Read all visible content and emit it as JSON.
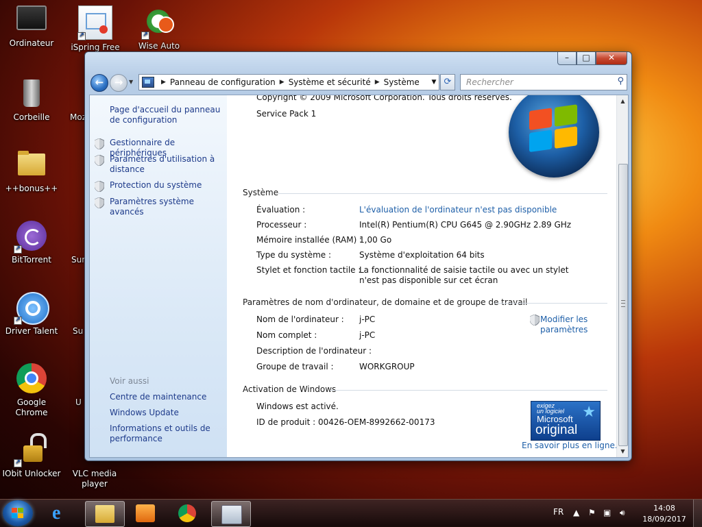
{
  "desktop": {
    "icons": [
      {
        "label": "Ordinateur"
      },
      {
        "label": "iSpring Free"
      },
      {
        "label": "Wise Auto"
      },
      {
        "label": "Corbeille"
      },
      {
        "label": "Moz"
      },
      {
        "label": "++bonus++"
      },
      {
        "label": "BitTorrent"
      },
      {
        "label": "Sur"
      },
      {
        "label": "Driver Talent"
      },
      {
        "label": "Su"
      },
      {
        "label": "Google Chrome"
      },
      {
        "label": "U"
      },
      {
        "label": "IObit Unlocker"
      },
      {
        "label": "VLC media player"
      }
    ]
  },
  "window": {
    "controls": {
      "minimize": "–",
      "maximize": "□",
      "close": "✕"
    },
    "nav": {
      "back": "←",
      "forward": "→"
    },
    "address": {
      "crumbs": [
        "Panneau de configuration",
        "Système et sécurité",
        "Système"
      ]
    },
    "search": {
      "placeholder": "Rechercher"
    },
    "left_pane": {
      "home": "Page d'accueil du panneau de configuration",
      "links": [
        "Gestionnaire de périphériques",
        "Paramètres d'utilisation à distance",
        "Protection du système",
        "Paramètres système avancés"
      ],
      "see_also_title": "Voir aussi",
      "see_also": [
        "Centre de maintenance",
        "Windows Update",
        "Informations et outils de performance"
      ]
    },
    "main": {
      "copyright": "Copyright © 2009 Microsoft Corporation. Tous droits réservés.",
      "service_pack": "Service Pack 1",
      "system_section": "Système",
      "system_rows": [
        {
          "label": "Évaluation :",
          "value": "L'évaluation de l'ordinateur n'est pas disponible"
        },
        {
          "label": "Processeur :",
          "value": "Intel(R) Pentium(R) CPU G645 @ 2.90GHz   2.89 GHz"
        },
        {
          "label": "Mémoire installée (RAM) :",
          "value": "1,00 Go"
        },
        {
          "label": "Type du système :",
          "value": "Système d'exploitation 64 bits"
        },
        {
          "label": "Stylet et fonction tactile :",
          "value": "La fonctionnalité de saisie tactile ou avec un stylet n'est pas disponible sur cet écran"
        }
      ],
      "computer_section": "Paramètres de nom d'ordinateur, de domaine et de groupe de travail",
      "computer_rows": [
        {
          "label": "Nom de l'ordinateur :",
          "value": "j-PC"
        },
        {
          "label": "Nom complet :",
          "value": "j-PC"
        },
        {
          "label": "Description de l'ordinateur :",
          "value": ""
        },
        {
          "label": "Groupe de travail :",
          "value": "WORKGROUP"
        }
      ],
      "modify_link": "Modifier les paramètres",
      "activation_section": "Activation de Windows",
      "activation_status": "Windows est activé.",
      "product_id": "ID de produit : 00426-OEM-8992662-00173",
      "genuine": {
        "line1": "exigez",
        "line2": "un logiciel",
        "line3": "Microsoft",
        "line4": "original"
      },
      "learn_more": "En savoir plus en ligne..."
    }
  },
  "taskbar": {
    "language": "FR",
    "time": "14:08",
    "date": "18/09/2017"
  }
}
